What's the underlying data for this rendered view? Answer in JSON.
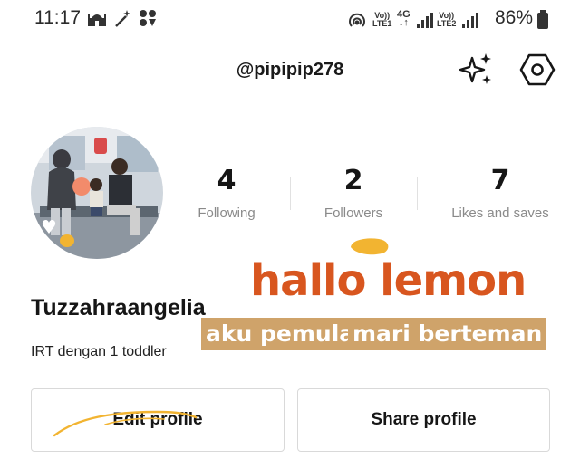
{
  "status_bar": {
    "time": "11:17",
    "battery": "86%",
    "net1": "Vo)) LTE1",
    "net1_top": "Vo))",
    "net1_bot": "LTE1",
    "net_4g": "4G",
    "net2_top": "Vo))",
    "net2_bot": "LTE2",
    "icons": [
      "mosque-icon",
      "magic-wand-icon",
      "apps-grid-icon",
      "hotspot-icon",
      "signal-icon",
      "signal-icon",
      "battery-icon"
    ]
  },
  "header": {
    "username": "@pipipip278",
    "icons": [
      "sparkle-icon",
      "settings-hexagon-icon"
    ]
  },
  "stats": [
    {
      "value": "4",
      "label": "Following"
    },
    {
      "value": "2",
      "label": "Followers"
    },
    {
      "value": "7",
      "label": "Likes and saves"
    }
  ],
  "profile": {
    "name": "Tuzzahraangelia",
    "bio": "IRT dengan 1 toddler"
  },
  "sticker": {
    "title": "hallo lemon",
    "tag1": "aku pemula",
    "tag2": "mari berteman"
  },
  "buttons": {
    "edit": "Edit profile",
    "share": "Share profile"
  },
  "colors": {
    "sticker_orange": "#d8561f",
    "tag_bg": "#cfa36a",
    "blob_yellow": "#f2b431"
  }
}
